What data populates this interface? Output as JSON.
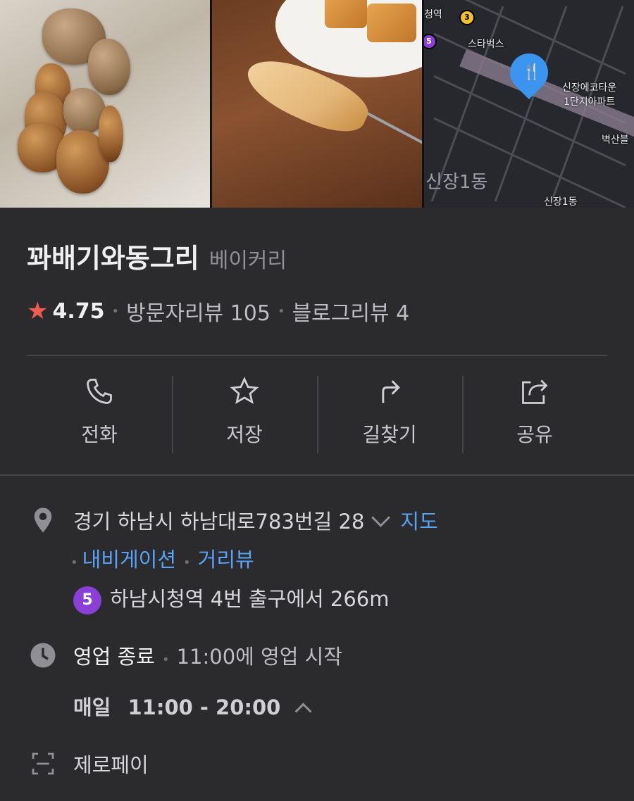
{
  "map": {
    "labels": {
      "station": "청역",
      "starbucks": "스타벅스",
      "apt": "신장에코타운\n1단지아파트",
      "byeoksan": "벽산블",
      "area": "신장1동",
      "area_small": "신장1동"
    },
    "line_badges": [
      "3",
      "5"
    ]
  },
  "place": {
    "name": "꽈배기와동그리",
    "category": "베이커리"
  },
  "rating": {
    "score": "4.75",
    "visit_reviews": "방문자리뷰 105",
    "blog_reviews": "블로그리뷰 4"
  },
  "actions": [
    {
      "label": "전화",
      "icon": "phone-icon"
    },
    {
      "label": "저장",
      "icon": "star-outline-icon"
    },
    {
      "label": "길찾기",
      "icon": "directions-icon"
    },
    {
      "label": "공유",
      "icon": "share-icon"
    }
  ],
  "address": {
    "text": "경기 하남시 하남대로783번길 28",
    "map_link": "지도",
    "navigation_link": "내비게이션",
    "streetview_link": "거리뷰",
    "subway_line": "5",
    "subway_info": "하남시청역 4번 출구에서 266m"
  },
  "hours": {
    "status": "영업 종료",
    "next_open": "11:00에 영업 시작",
    "days": "매일",
    "range": "11:00 - 20:00"
  },
  "payment": {
    "label": "제로페이"
  },
  "colors": {
    "background": "#2b2b2e",
    "accent_link": "#5aa2f5",
    "star": "#f25b50",
    "subway_line5": "#8a3fd6",
    "marker": "#3b94ee"
  }
}
